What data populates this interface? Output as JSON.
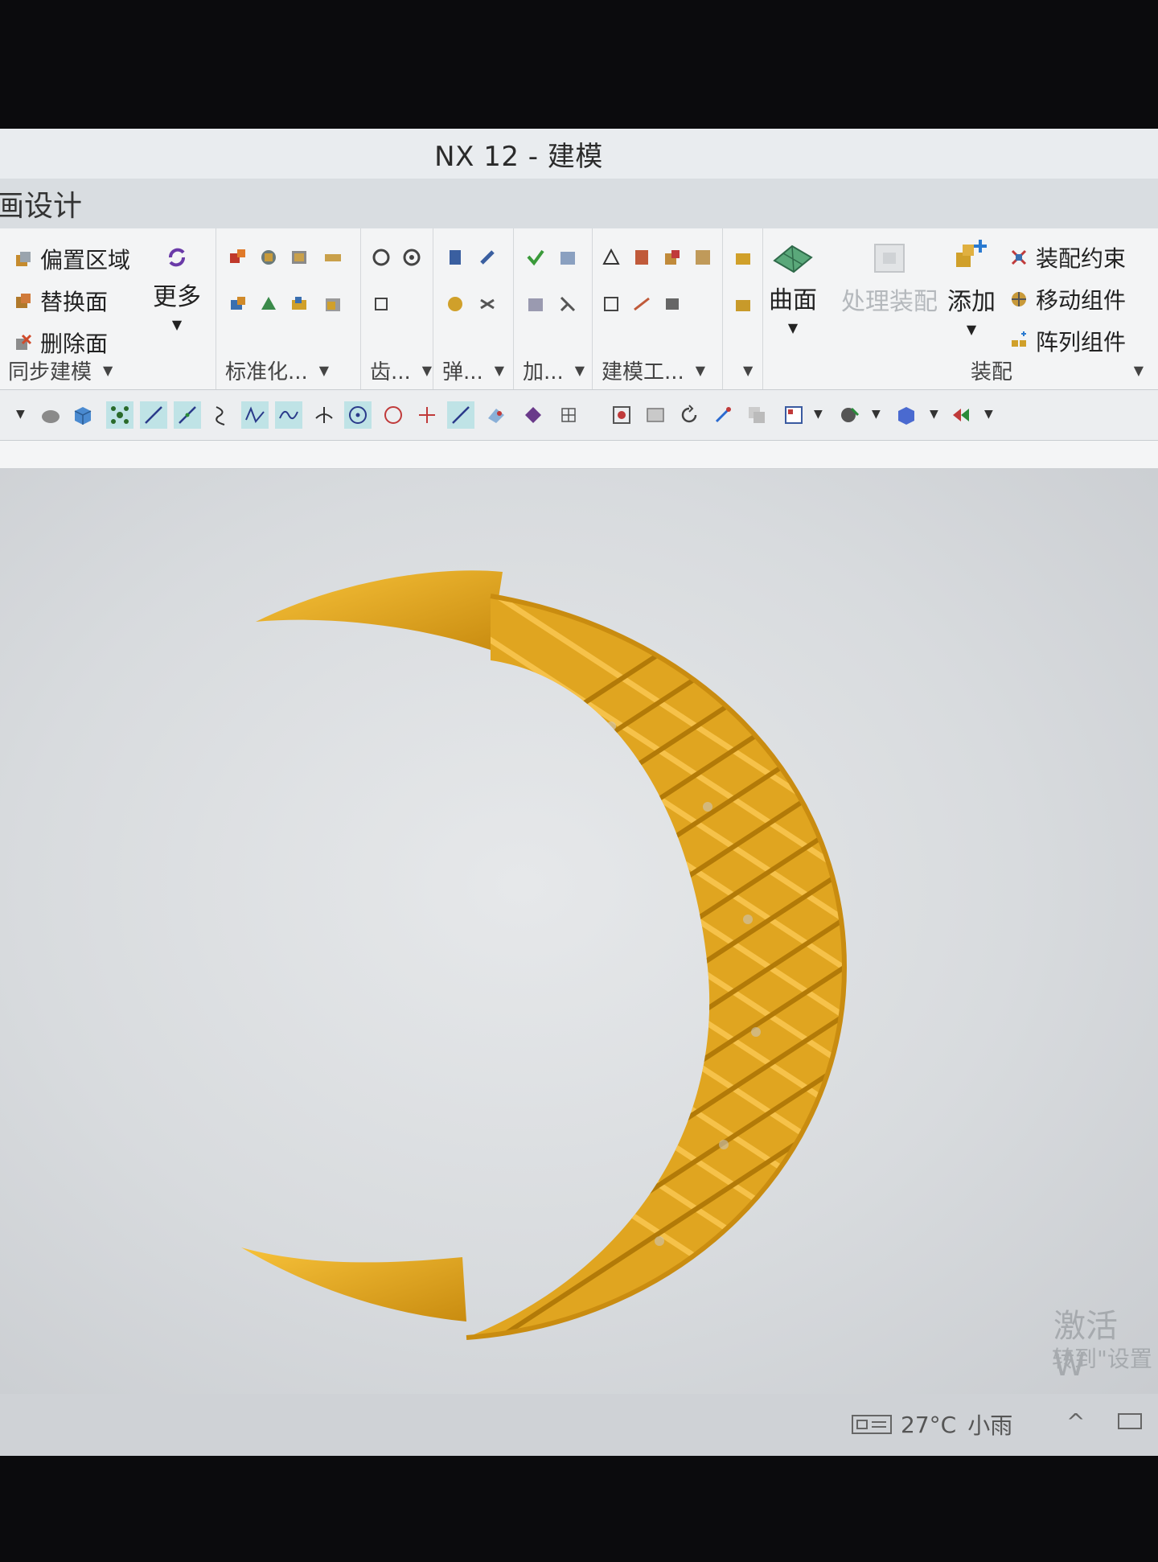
{
  "window": {
    "title": "NX 12 - 建模"
  },
  "tabs": {
    "active_partial": "画设计"
  },
  "ribbon": {
    "sync_modeling": {
      "items": [
        {
          "label": "偏置区域",
          "icon": "offset-region-icon"
        },
        {
          "label": "替换面",
          "icon": "replace-face-icon"
        },
        {
          "label": "删除面",
          "icon": "delete-face-icon"
        }
      ],
      "more_label": "更多",
      "group_label": "同步建模"
    },
    "groups": [
      {
        "label": "标准化..."
      },
      {
        "label": "齿..."
      },
      {
        "label": "弹..."
      },
      {
        "label": "加..."
      },
      {
        "label": "建模工..."
      }
    ],
    "surface": {
      "label": "曲面"
    },
    "assembly": {
      "process_label": "处理装配",
      "add_label": "添加",
      "items": [
        {
          "label": "装配约束",
          "icon": "assembly-constraint-icon"
        },
        {
          "label": "移动组件",
          "icon": "move-component-icon"
        },
        {
          "label": "阵列组件",
          "icon": "pattern-component-icon"
        }
      ],
      "group_label": "装配"
    }
  },
  "watermark": {
    "line1": "激活 W",
    "line2": "转到\"设置"
  },
  "taskbar": {
    "temperature": "27°C",
    "weather": "小雨"
  },
  "colors": {
    "accent_selected": "#bfe3e6",
    "model_gold": "#f0b020"
  }
}
